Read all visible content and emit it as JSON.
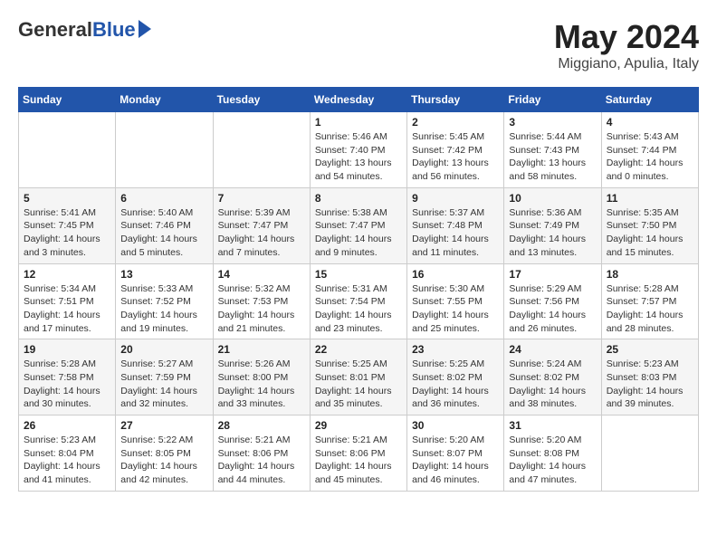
{
  "header": {
    "logo_general": "General",
    "logo_blue": "Blue",
    "month_year": "May 2024",
    "location": "Miggiano, Apulia, Italy"
  },
  "days_of_week": [
    "Sunday",
    "Monday",
    "Tuesday",
    "Wednesday",
    "Thursday",
    "Friday",
    "Saturday"
  ],
  "weeks": [
    [
      {
        "day": "",
        "info": ""
      },
      {
        "day": "",
        "info": ""
      },
      {
        "day": "",
        "info": ""
      },
      {
        "day": "1",
        "info": "Sunrise: 5:46 AM\nSunset: 7:40 PM\nDaylight: 13 hours and 54 minutes."
      },
      {
        "day": "2",
        "info": "Sunrise: 5:45 AM\nSunset: 7:42 PM\nDaylight: 13 hours and 56 minutes."
      },
      {
        "day": "3",
        "info": "Sunrise: 5:44 AM\nSunset: 7:43 PM\nDaylight: 13 hours and 58 minutes."
      },
      {
        "day": "4",
        "info": "Sunrise: 5:43 AM\nSunset: 7:44 PM\nDaylight: 14 hours and 0 minutes."
      }
    ],
    [
      {
        "day": "5",
        "info": "Sunrise: 5:41 AM\nSunset: 7:45 PM\nDaylight: 14 hours and 3 minutes."
      },
      {
        "day": "6",
        "info": "Sunrise: 5:40 AM\nSunset: 7:46 PM\nDaylight: 14 hours and 5 minutes."
      },
      {
        "day": "7",
        "info": "Sunrise: 5:39 AM\nSunset: 7:47 PM\nDaylight: 14 hours and 7 minutes."
      },
      {
        "day": "8",
        "info": "Sunrise: 5:38 AM\nSunset: 7:47 PM\nDaylight: 14 hours and 9 minutes."
      },
      {
        "day": "9",
        "info": "Sunrise: 5:37 AM\nSunset: 7:48 PM\nDaylight: 14 hours and 11 minutes."
      },
      {
        "day": "10",
        "info": "Sunrise: 5:36 AM\nSunset: 7:49 PM\nDaylight: 14 hours and 13 minutes."
      },
      {
        "day": "11",
        "info": "Sunrise: 5:35 AM\nSunset: 7:50 PM\nDaylight: 14 hours and 15 minutes."
      }
    ],
    [
      {
        "day": "12",
        "info": "Sunrise: 5:34 AM\nSunset: 7:51 PM\nDaylight: 14 hours and 17 minutes."
      },
      {
        "day": "13",
        "info": "Sunrise: 5:33 AM\nSunset: 7:52 PM\nDaylight: 14 hours and 19 minutes."
      },
      {
        "day": "14",
        "info": "Sunrise: 5:32 AM\nSunset: 7:53 PM\nDaylight: 14 hours and 21 minutes."
      },
      {
        "day": "15",
        "info": "Sunrise: 5:31 AM\nSunset: 7:54 PM\nDaylight: 14 hours and 23 minutes."
      },
      {
        "day": "16",
        "info": "Sunrise: 5:30 AM\nSunset: 7:55 PM\nDaylight: 14 hours and 25 minutes."
      },
      {
        "day": "17",
        "info": "Sunrise: 5:29 AM\nSunset: 7:56 PM\nDaylight: 14 hours and 26 minutes."
      },
      {
        "day": "18",
        "info": "Sunrise: 5:28 AM\nSunset: 7:57 PM\nDaylight: 14 hours and 28 minutes."
      }
    ],
    [
      {
        "day": "19",
        "info": "Sunrise: 5:28 AM\nSunset: 7:58 PM\nDaylight: 14 hours and 30 minutes."
      },
      {
        "day": "20",
        "info": "Sunrise: 5:27 AM\nSunset: 7:59 PM\nDaylight: 14 hours and 32 minutes."
      },
      {
        "day": "21",
        "info": "Sunrise: 5:26 AM\nSunset: 8:00 PM\nDaylight: 14 hours and 33 minutes."
      },
      {
        "day": "22",
        "info": "Sunrise: 5:25 AM\nSunset: 8:01 PM\nDaylight: 14 hours and 35 minutes."
      },
      {
        "day": "23",
        "info": "Sunrise: 5:25 AM\nSunset: 8:02 PM\nDaylight: 14 hours and 36 minutes."
      },
      {
        "day": "24",
        "info": "Sunrise: 5:24 AM\nSunset: 8:02 PM\nDaylight: 14 hours and 38 minutes."
      },
      {
        "day": "25",
        "info": "Sunrise: 5:23 AM\nSunset: 8:03 PM\nDaylight: 14 hours and 39 minutes."
      }
    ],
    [
      {
        "day": "26",
        "info": "Sunrise: 5:23 AM\nSunset: 8:04 PM\nDaylight: 14 hours and 41 minutes."
      },
      {
        "day": "27",
        "info": "Sunrise: 5:22 AM\nSunset: 8:05 PM\nDaylight: 14 hours and 42 minutes."
      },
      {
        "day": "28",
        "info": "Sunrise: 5:21 AM\nSunset: 8:06 PM\nDaylight: 14 hours and 44 minutes."
      },
      {
        "day": "29",
        "info": "Sunrise: 5:21 AM\nSunset: 8:06 PM\nDaylight: 14 hours and 45 minutes."
      },
      {
        "day": "30",
        "info": "Sunrise: 5:20 AM\nSunset: 8:07 PM\nDaylight: 14 hours and 46 minutes."
      },
      {
        "day": "31",
        "info": "Sunrise: 5:20 AM\nSunset: 8:08 PM\nDaylight: 14 hours and 47 minutes."
      },
      {
        "day": "",
        "info": ""
      }
    ]
  ]
}
